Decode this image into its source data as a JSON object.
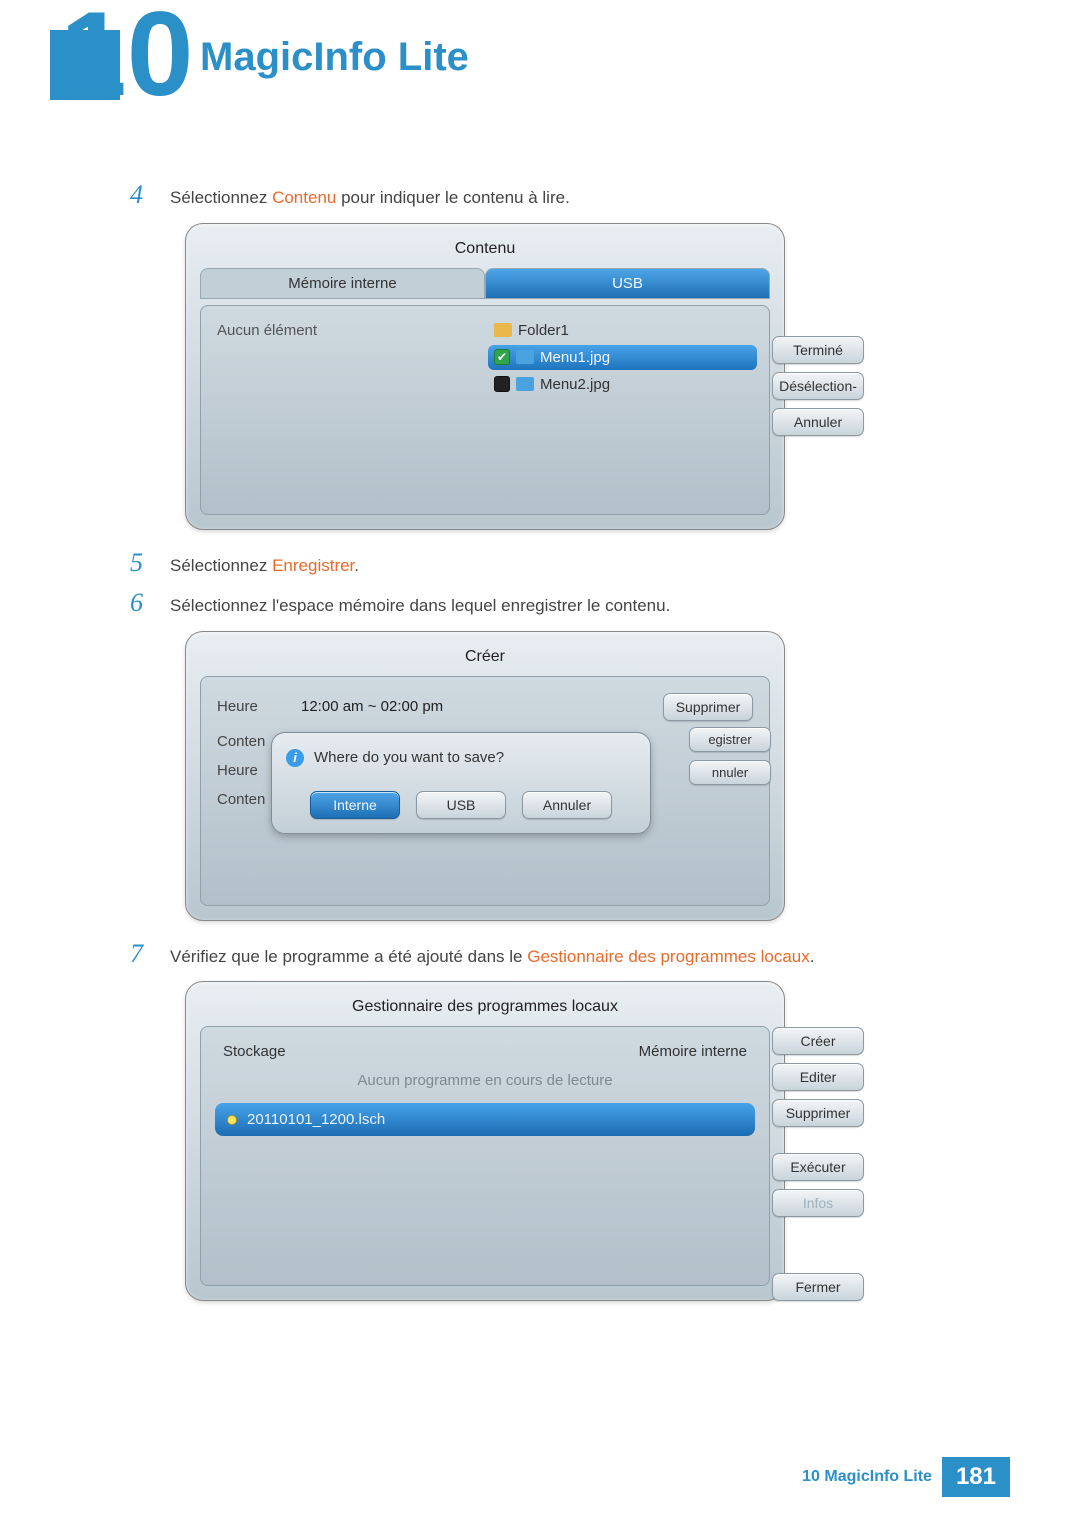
{
  "chapter": {
    "num": "10",
    "title": "MagicInfo Lite"
  },
  "steps": {
    "s4": {
      "num": "4",
      "pre": "Sélectionnez ",
      "hl": "Contenu",
      "post": " pour indiquer le contenu à lire."
    },
    "s5": {
      "num": "5",
      "pre": "Sélectionnez ",
      "hl": "Enregistrer",
      "post": "."
    },
    "s6": {
      "num": "6",
      "text": "Sélectionnez l'espace mémoire dans lequel enregistrer le contenu."
    },
    "s7": {
      "num": "7",
      "pre": "Vérifiez que le programme a été ajouté dans le ",
      "hl": "Gestionnaire des programmes locaux",
      "post": "."
    }
  },
  "panel1": {
    "title": "Contenu",
    "tab1": "Mémoire interne",
    "tab2": "USB",
    "left_empty": "Aucun élément",
    "folder": "Folder1",
    "file1": "Menu1.jpg",
    "file2": "Menu2.jpg",
    "btn_done": "Terminé",
    "btn_deselect": "Désélection-",
    "btn_cancel": "Annuler"
  },
  "panel2": {
    "title": "Créer",
    "k_time": "Heure",
    "v_time": "12:00 am ~ 02:00 pm",
    "btn_delete": "Supprimer",
    "k_content": "Conten",
    "k_time2": "Heure",
    "k_content2": "Conten",
    "side_save": "egistrer",
    "side_cancel": "nnuler",
    "modal_text": "Where do you want to save?",
    "btn_internal": "Interne",
    "btn_usb": "USB",
    "btn_cancel": "Annuler"
  },
  "panel3": {
    "title": "Gestionnaire des programmes locaux",
    "k_storage": "Stockage",
    "v_storage": "Mémoire interne",
    "nowplaying": "Aucun programme en cours de lecture",
    "sched": "20110101_1200.lsch",
    "btn_create": "Créer",
    "btn_edit": "Editer",
    "btn_delete": "Supprimer",
    "btn_run": "Exécuter",
    "btn_info": "Infos",
    "btn_close": "Fermer"
  },
  "footer": {
    "label": "10 MagicInfo Lite",
    "page": "181"
  }
}
